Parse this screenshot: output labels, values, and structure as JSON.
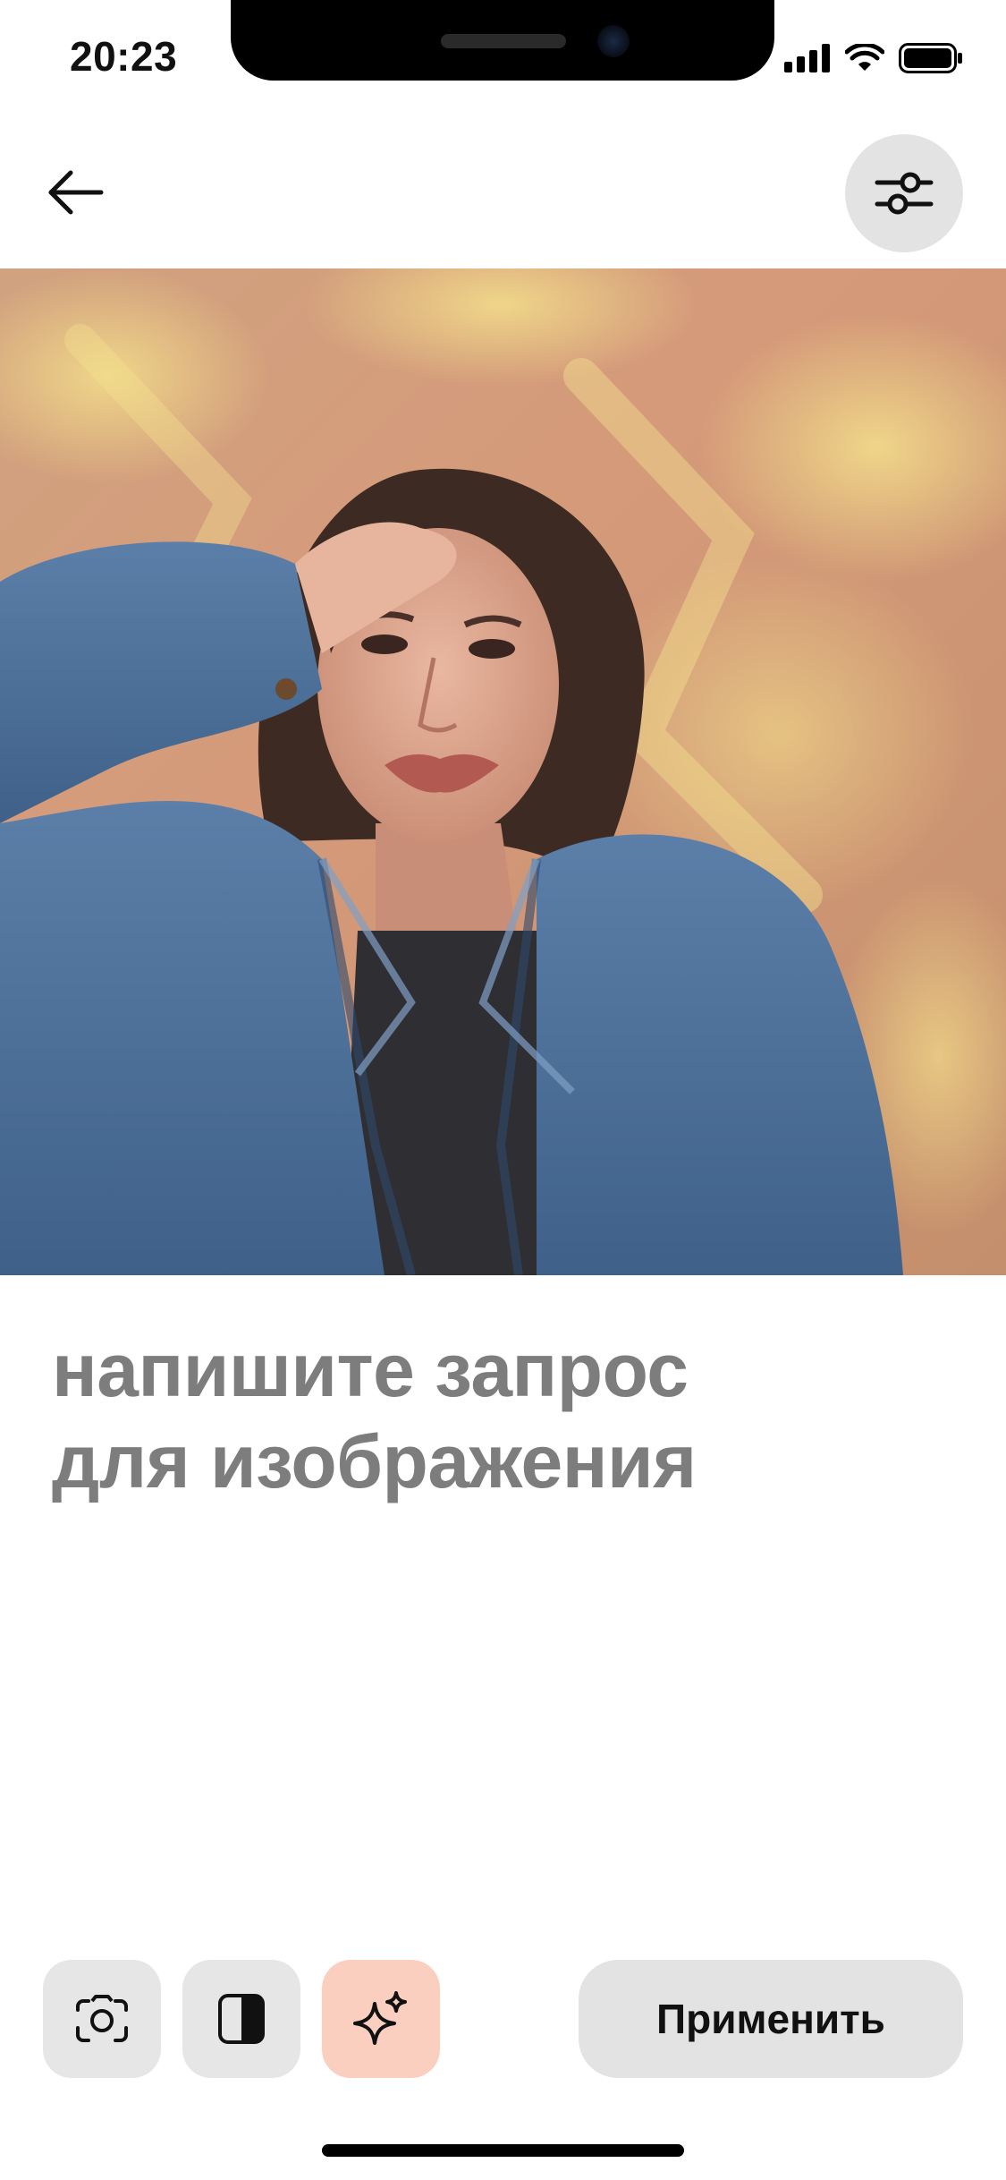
{
  "status_bar": {
    "time": "20:23",
    "icons": [
      "cellular-signal-icon",
      "wifi-icon",
      "battery-icon"
    ]
  },
  "header": {
    "back_icon": "arrow-left-icon",
    "settings_icon": "sliders-icon"
  },
  "photo": {
    "subject": "portrait-photo"
  },
  "prompt": {
    "placeholder_line1": "напишите запрос",
    "placeholder_line2": "для изображения"
  },
  "toolbar": {
    "buttons": [
      {
        "icon": "camera-icon"
      },
      {
        "icon": "split-layout-icon"
      },
      {
        "icon": "sparkle-icon",
        "active": true,
        "color": "#fbcfc0"
      }
    ],
    "apply_label": "Применить"
  },
  "colors": {
    "prompt_text": "#7d7d7d",
    "button_bg": "#e3e3e3",
    "accent_bg": "#fbcfc0"
  }
}
